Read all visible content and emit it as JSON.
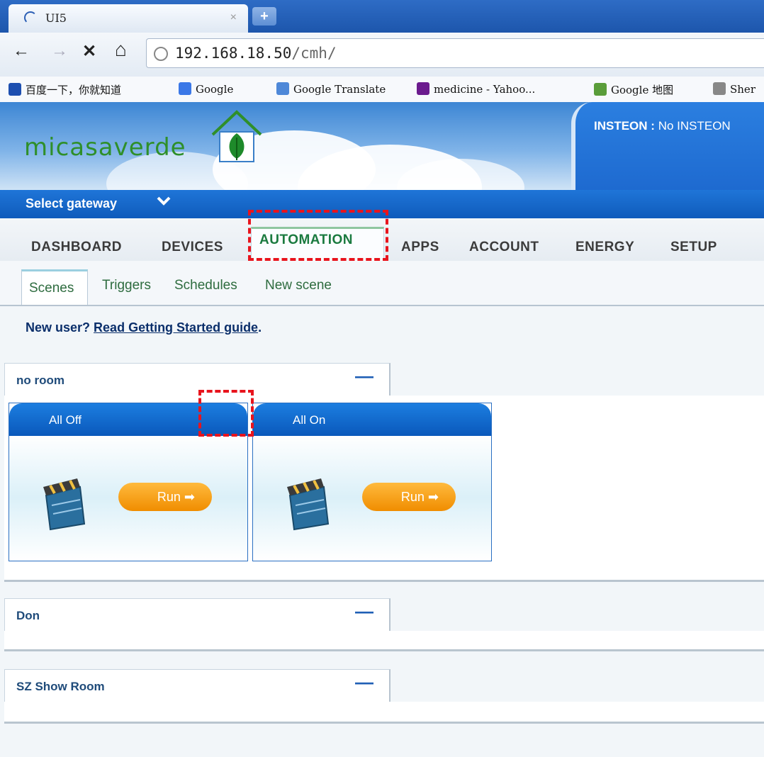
{
  "browser": {
    "tab_title": "UI5",
    "tab_close": "×",
    "new_tab": "+",
    "url_host": "192.168.18.50",
    "url_path": "/cmh/",
    "back_icon": "←",
    "forward_icon": "→",
    "stop_icon": "✕",
    "home_icon": "⌂"
  },
  "bookmarks": [
    {
      "label": "百度一下，你就知道",
      "icon": "baidu-icon",
      "color": "#1d4fb0"
    },
    {
      "label": "Google",
      "icon": "google-icon",
      "color": "#3b78e7"
    },
    {
      "label": "Google Translate",
      "icon": "translate-icon",
      "color": "#4e88d8"
    },
    {
      "label": "medicine - Yahoo...",
      "icon": "yahoo-icon",
      "color": "#6b1b8e"
    },
    {
      "label": "Google 地图",
      "icon": "maps-icon",
      "color": "#5a9d3a"
    },
    {
      "label": "Sher",
      "icon": "globe-icon",
      "color": "#888888"
    }
  ],
  "header": {
    "logo_text": "micasaverde",
    "insteon_label": "INSTEON :",
    "insteon_value": "No INSTEON"
  },
  "gateway": {
    "label": "Select gateway",
    "chevron": "❯"
  },
  "main_nav": [
    {
      "label": "DASHBOARD",
      "active": false
    },
    {
      "label": "DEVICES",
      "active": false
    },
    {
      "label": "AUTOMATION",
      "active": true
    },
    {
      "label": "APPS",
      "active": false
    },
    {
      "label": "ACCOUNT",
      "active": false
    },
    {
      "label": "ENERGY",
      "active": false
    },
    {
      "label": "SETUP",
      "active": false
    }
  ],
  "sub_nav": [
    {
      "label": "Scenes",
      "active": true
    },
    {
      "label": "Triggers",
      "active": false
    },
    {
      "label": "Schedules",
      "active": false
    },
    {
      "label": "New scene",
      "active": false
    }
  ],
  "guide": {
    "prefix": "New user?",
    "link": "Read Getting Started guide",
    "suffix": "."
  },
  "rooms": [
    {
      "name": "no room",
      "collapse": "—",
      "scenes": [
        {
          "name": "All Off",
          "run_label": "Run"
        },
        {
          "name": "All On",
          "run_label": "Run"
        }
      ]
    },
    {
      "name": "Don",
      "collapse": "—",
      "scenes": []
    },
    {
      "name": "SZ Show Room",
      "collapse": "—",
      "scenes": []
    }
  ],
  "colors": {
    "brand_blue": "#0f5bbb",
    "active_nav": "#1a7a3f",
    "run_orange": "#f08d00",
    "highlight_red": "#e8141d"
  }
}
